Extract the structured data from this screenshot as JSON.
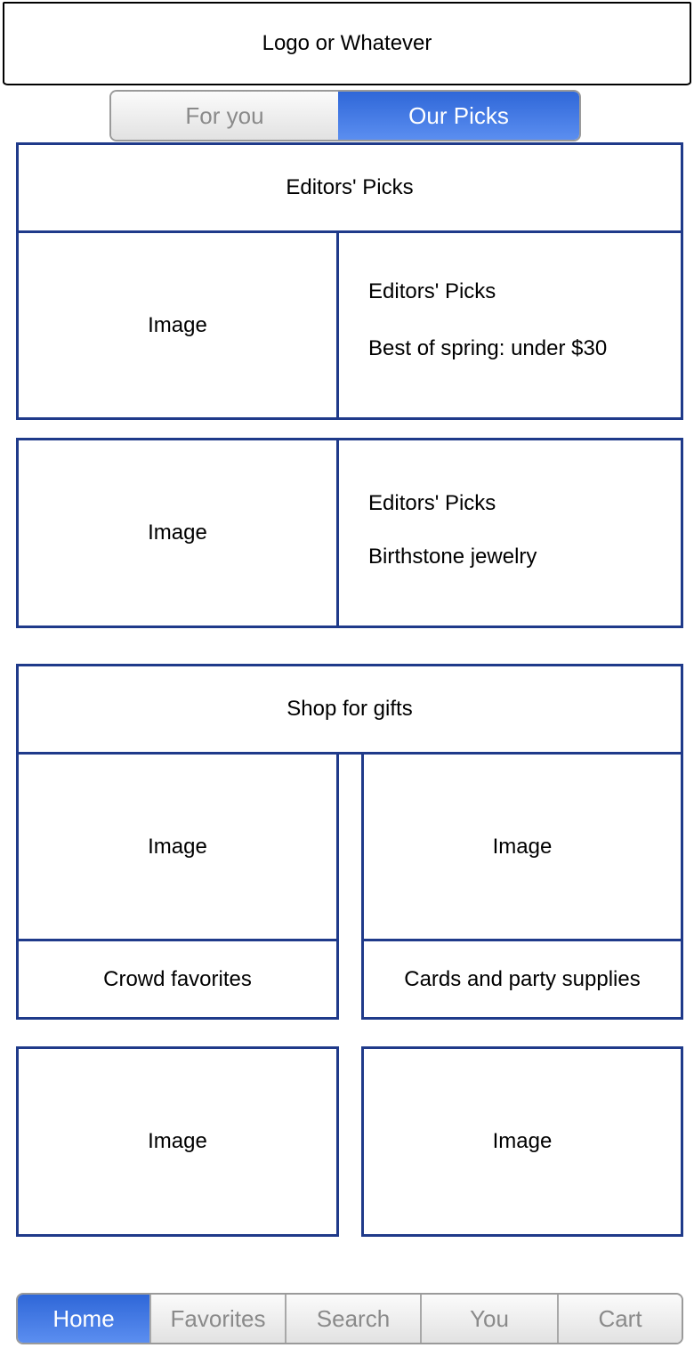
{
  "header": {
    "logo_text": "Logo or Whatever"
  },
  "segmented": {
    "options": [
      {
        "label": "For you",
        "active": false
      },
      {
        "label": "Our Picks",
        "active": true
      }
    ]
  },
  "editors_picks": {
    "title": "Editors' Picks",
    "cards": [
      {
        "image_label": "Image",
        "kicker": "Editors' Picks",
        "subtitle": "Best of spring: under $30"
      },
      {
        "image_label": "Image",
        "kicker": "Editors' Picks",
        "subtitle": "Birthstone jewelry"
      }
    ]
  },
  "gifts": {
    "title": "Shop for gifts",
    "items": [
      {
        "image_label": "Image",
        "caption": "Crowd favorites"
      },
      {
        "image_label": "Image",
        "caption": "Cards and party supplies"
      },
      {
        "image_label": "Image"
      },
      {
        "image_label": "Image"
      }
    ]
  },
  "tabbar": {
    "tabs": [
      {
        "label": "Home",
        "active": true
      },
      {
        "label": "Favorites",
        "active": false
      },
      {
        "label": "Search",
        "active": false
      },
      {
        "label": "You",
        "active": false
      },
      {
        "label": "Cart",
        "active": false
      }
    ]
  },
  "colors": {
    "accent": "#2f67d8",
    "card_border": "#1f3a8a",
    "inactive_text": "#8a8a8a"
  }
}
